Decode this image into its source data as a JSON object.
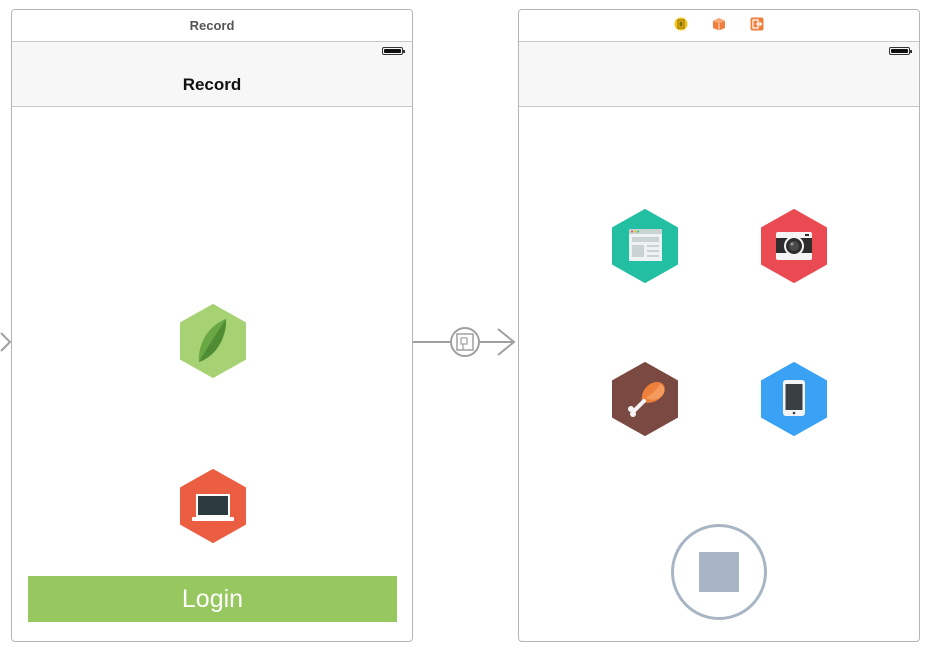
{
  "storyboard": {
    "left_scene": {
      "dock_title": "Record",
      "nav_title": "Record",
      "icons": [
        "leaf-icon",
        "laptop-icon"
      ],
      "login_label": "Login"
    },
    "right_scene": {
      "dock_icons": [
        "view-controller-icon",
        "first-responder-icon",
        "exit-icon"
      ],
      "icons": [
        "browser-icon",
        "camera-icon",
        "chicken-leg-icon",
        "tablet-icon"
      ],
      "stop_icon": "stop-icon"
    },
    "connections": {
      "entry": "entry-arrow-icon",
      "segue": "segue-icon"
    }
  },
  "colors": {
    "leaf_hex": "#a6d274",
    "laptop_hex": "#ec5e41",
    "browser_hex": "#23bfa2",
    "camera_hex": "#ea4a52",
    "chicken_hex": "#7a4a42",
    "tablet_hex": "#3aa2f4",
    "login_button": "#96c85f",
    "stop_ring": "#a8b5c4"
  }
}
